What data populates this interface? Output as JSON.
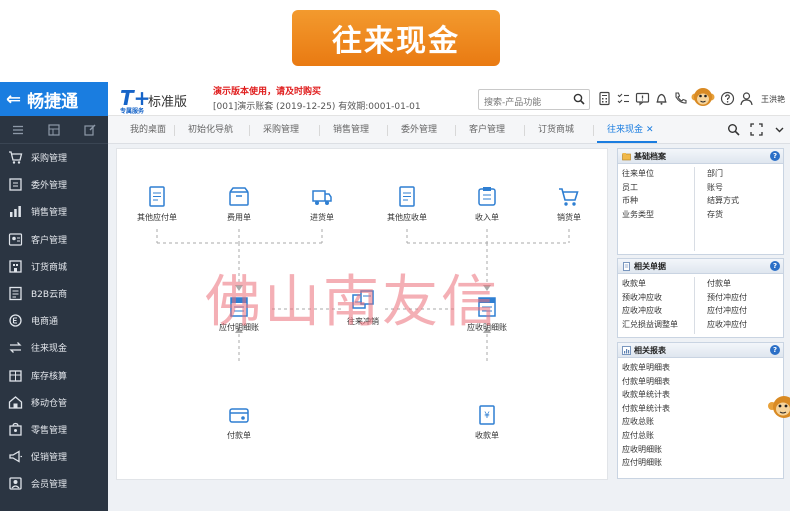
{
  "banner": {
    "title": "往来现金"
  },
  "header": {
    "brand": "畅捷通",
    "product_logo": "T+",
    "product_logo_sub": "专属服务",
    "edition": "标准版",
    "demo_note": "演示版本使用，请及时购买",
    "account_info": "[001]演示账套   (2019-12-25)   有效期:0001-01-01",
    "search_placeholder": "搜索-产品功能",
    "username": "王洪艳",
    "colors": {
      "brand_blue": "#1a7de0",
      "sidebar_bg": "#2b3542",
      "banner_orange": "#ef8a1f"
    }
  },
  "sidebar": {
    "items": [
      {
        "label": "采购管理",
        "icon": "cart-icon"
      },
      {
        "label": "委外管理",
        "icon": "outsource-icon"
      },
      {
        "label": "销售管理",
        "icon": "bar-chart-icon"
      },
      {
        "label": "客户管理",
        "icon": "customer-icon"
      },
      {
        "label": "订货商城",
        "icon": "store-icon"
      },
      {
        "label": "B2B云商",
        "icon": "b2b-icon"
      },
      {
        "label": "电商通",
        "icon": "ecommerce-icon"
      },
      {
        "label": "往来现金",
        "icon": "exchange-icon"
      },
      {
        "label": "库存核算",
        "icon": "inventory-icon"
      },
      {
        "label": "移动仓管",
        "icon": "mobile-warehouse-icon"
      },
      {
        "label": "零售管理",
        "icon": "retail-icon"
      },
      {
        "label": "促销管理",
        "icon": "megaphone-icon"
      },
      {
        "label": "会员管理",
        "icon": "member-icon"
      }
    ]
  },
  "tabs": [
    "我的桌面",
    "初始化导航",
    "采购管理",
    "销售管理",
    "委外管理",
    "客户管理",
    "订货商城",
    "往来现金"
  ],
  "flow": {
    "top": [
      "其他应付单",
      "费用单",
      "进货单",
      "其他应收单",
      "收入单",
      "销货单"
    ],
    "middle": [
      "应付明细账",
      "往来冲销",
      "应收明细账"
    ],
    "bottom": [
      "付款单",
      "收款单"
    ],
    "watermark": "佛山南友信"
  },
  "panels": {
    "basic": {
      "title": "基础档案",
      "left": [
        "往来单位",
        "员工",
        "币种",
        "业务类型"
      ],
      "right": [
        "部门",
        "账号",
        "结算方式",
        "存货"
      ]
    },
    "docs": {
      "title": "相关单据",
      "left": [
        "收款单",
        "预收冲应收",
        "应收冲应收",
        "汇兑损益调整单"
      ],
      "right": [
        "付款单",
        "预付冲应付",
        "应付冲应付",
        "应收冲应付"
      ]
    },
    "reports": {
      "title": "相关报表",
      "items": [
        "收款单明细表",
        "付款单明细表",
        "收款单统计表",
        "付款单统计表",
        "应收总账",
        "应付总账",
        "应收明细账",
        "应付明细账"
      ]
    },
    "help": "?"
  }
}
